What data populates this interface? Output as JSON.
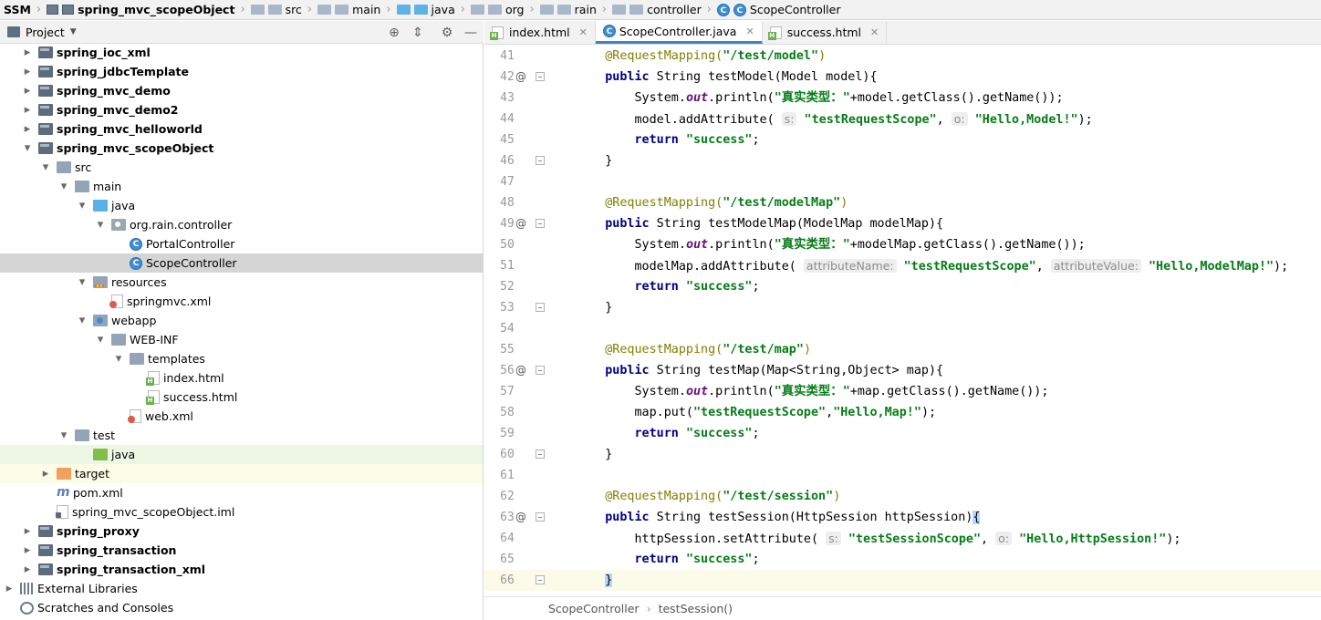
{
  "breadcrumb": [
    {
      "label": "SSM",
      "icon": "module-icon",
      "bold": true
    },
    {
      "label": "spring_mvc_scopeObject",
      "icon": "module-icon",
      "bold": true
    },
    {
      "label": "src",
      "icon": "folder-icon"
    },
    {
      "label": "main",
      "icon": "folder-icon"
    },
    {
      "label": "java",
      "icon": "source-folder-icon"
    },
    {
      "label": "org",
      "icon": "folder-icon"
    },
    {
      "label": "rain",
      "icon": "folder-icon"
    },
    {
      "label": "controller",
      "icon": "folder-icon"
    },
    {
      "label": "ScopeController",
      "icon": "class-icon"
    }
  ],
  "project_panel": {
    "title": "Project"
  },
  "tree": [
    {
      "label": "spring_ioc_xml",
      "depth": 1,
      "arrow": "right",
      "icon": "mod",
      "bold": true
    },
    {
      "label": "spring_jdbcTemplate",
      "depth": 1,
      "arrow": "right",
      "icon": "mod",
      "bold": true
    },
    {
      "label": "spring_mvc_demo",
      "depth": 1,
      "arrow": "right",
      "icon": "mod",
      "bold": true
    },
    {
      "label": "spring_mvc_demo2",
      "depth": 1,
      "arrow": "right",
      "icon": "mod",
      "bold": true
    },
    {
      "label": "spring_mvc_helloworld",
      "depth": 1,
      "arrow": "right",
      "icon": "mod",
      "bold": true
    },
    {
      "label": "spring_mvc_scopeObject",
      "depth": 1,
      "arrow": "down",
      "icon": "mod",
      "bold": true
    },
    {
      "label": "src",
      "depth": 2,
      "arrow": "down",
      "icon": "fold"
    },
    {
      "label": "main",
      "depth": 3,
      "arrow": "down",
      "icon": "fold"
    },
    {
      "label": "java",
      "depth": 4,
      "arrow": "down",
      "icon": "foldblue"
    },
    {
      "label": "org.rain.controller",
      "depth": 5,
      "arrow": "down",
      "icon": "pkg"
    },
    {
      "label": "PortalController",
      "depth": 6,
      "arrow": "none",
      "icon": "cls"
    },
    {
      "label": "ScopeController",
      "depth": 6,
      "arrow": "none",
      "icon": "cls",
      "selected": true
    },
    {
      "label": "resources",
      "depth": 4,
      "arrow": "down",
      "icon": "foldres"
    },
    {
      "label": "springmvc.xml",
      "depth": 5,
      "arrow": "none",
      "icon": "xml"
    },
    {
      "label": "webapp",
      "depth": 4,
      "arrow": "down",
      "icon": "foldweb"
    },
    {
      "label": "WEB-INF",
      "depth": 5,
      "arrow": "down",
      "icon": "fold"
    },
    {
      "label": "templates",
      "depth": 6,
      "arrow": "down",
      "icon": "fold"
    },
    {
      "label": "index.html",
      "depth": 7,
      "arrow": "none",
      "icon": "html"
    },
    {
      "label": "success.html",
      "depth": 7,
      "arrow": "none",
      "icon": "html"
    },
    {
      "label": "web.xml",
      "depth": 6,
      "arrow": "none",
      "icon": "xml"
    },
    {
      "label": "test",
      "depth": 3,
      "arrow": "down",
      "icon": "fold"
    },
    {
      "label": "java",
      "depth": 4,
      "arrow": "none",
      "icon": "foldgreen",
      "highlight": "test"
    },
    {
      "label": "target",
      "depth": 2,
      "arrow": "right",
      "icon": "foldorange",
      "highlight": "excl"
    },
    {
      "label": "pom.xml",
      "depth": 2,
      "arrow": "none",
      "icon": "pom"
    },
    {
      "label": "spring_mvc_scopeObject.iml",
      "depth": 2,
      "arrow": "none",
      "icon": "iml"
    },
    {
      "label": "spring_proxy",
      "depth": 1,
      "arrow": "right",
      "icon": "mod",
      "bold": true
    },
    {
      "label": "spring_transaction",
      "depth": 1,
      "arrow": "right",
      "icon": "mod",
      "bold": true
    },
    {
      "label": "spring_transaction_xml",
      "depth": 1,
      "arrow": "right",
      "icon": "mod",
      "bold": true
    },
    {
      "label": "External Libraries",
      "depth": 0,
      "arrow": "right",
      "icon": "libs"
    },
    {
      "label": "Scratches and Consoles",
      "depth": 0,
      "arrow": "none",
      "icon": "scr"
    }
  ],
  "tabs": [
    {
      "label": "index.html",
      "icon": "html",
      "active": false
    },
    {
      "label": "ScopeController.java",
      "icon": "cls",
      "active": true
    },
    {
      "label": "success.html",
      "icon": "html",
      "active": false
    }
  ],
  "code_lines": [
    {
      "n": "41",
      "html": "    <span class='a'>@RequestMapping(</span><span class='str'>\"/test/model\"</span><span class='a'>)</span>"
    },
    {
      "n": "42",
      "ann": "@",
      "fold": true,
      "html": "    <span class='kw'>public</span> String testModel(Model model){"
    },
    {
      "n": "43",
      "html": "        System.<span class='fld'>out</span>.println(<span class='str'>\"真实类型：\"</span>+model.getClass().getName());"
    },
    {
      "n": "44",
      "html": "        model.addAttribute( <span class='hint'>s:</span> <span class='str'>\"testRequestScope\"</span>, <span class='hint'>o:</span> <span class='str'>\"Hello,Model!\"</span>);"
    },
    {
      "n": "45",
      "html": "        <span class='kw'>return</span> <span class='str'>\"success\"</span>;"
    },
    {
      "n": "46",
      "fold": true,
      "html": "    }"
    },
    {
      "n": "47",
      "html": ""
    },
    {
      "n": "48",
      "html": "    <span class='a'>@RequestMapping(</span><span class='str'>\"/test/modelMap\"</span><span class='a'>)</span>"
    },
    {
      "n": "49",
      "ann": "@",
      "fold": true,
      "html": "    <span class='kw'>public</span> String testModelMap(ModelMap modelMap){"
    },
    {
      "n": "50",
      "html": "        System.<span class='fld'>out</span>.println(<span class='str'>\"真实类型：\"</span>+modelMap.getClass().getName());"
    },
    {
      "n": "51",
      "html": "        modelMap.addAttribute( <span class='hint'>attributeName:</span> <span class='str'>\"testRequestScope\"</span>, <span class='hint'>attributeValue:</span> <span class='str'>\"Hello,ModelMap!\"</span>);"
    },
    {
      "n": "52",
      "html": "        <span class='kw'>return</span> <span class='str'>\"success\"</span>;"
    },
    {
      "n": "53",
      "fold": true,
      "html": "    }"
    },
    {
      "n": "54",
      "html": ""
    },
    {
      "n": "55",
      "html": "    <span class='a'>@RequestMapping(</span><span class='str'>\"/test/map\"</span><span class='a'>)</span>"
    },
    {
      "n": "56",
      "ann": "@",
      "fold": true,
      "html": "    <span class='kw'>public</span> String testMap(Map&lt;String,Object&gt; map){"
    },
    {
      "n": "57",
      "html": "        System.<span class='fld'>out</span>.println(<span class='str'>\"真实类型：\"</span>+map.getClass().getName());"
    },
    {
      "n": "58",
      "html": "        map.put(<span class='str'>\"testRequestScope\"</span>,<span class='str'>\"Hello,Map!\"</span>);"
    },
    {
      "n": "59",
      "html": "        <span class='kw'>return</span> <span class='str'>\"success\"</span>;"
    },
    {
      "n": "60",
      "fold": true,
      "html": "    }"
    },
    {
      "n": "61",
      "html": ""
    },
    {
      "n": "62",
      "html": "    <span class='a'>@RequestMapping(</span><span class='str'>\"/test/session\"</span><span class='a'>)</span>"
    },
    {
      "n": "63",
      "ann": "@",
      "fold": true,
      "html": "    <span class='kw'>public</span> String testSession(HttpSession httpSession)<span class='brace'>{</span>"
    },
    {
      "n": "64",
      "html": "        httpSession.setAttribute( <span class='hint'>s:</span> <span class='str'>\"testSessionScope\"</span>, <span class='hint'>o:</span> <span class='str'>\"Hello,HttpSession!\"</span>);"
    },
    {
      "n": "65",
      "html": "        <span class='kw'>return</span> <span class='str'>\"success\"</span>;"
    },
    {
      "n": "66",
      "fold": true,
      "current": true,
      "html": "    <span class='brace'>}</span>"
    }
  ],
  "status_breadcrumb": [
    "ScopeController",
    "testSession()"
  ]
}
